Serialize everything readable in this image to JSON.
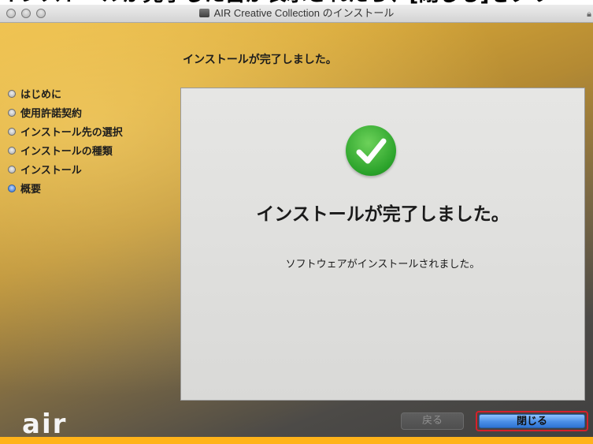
{
  "top_strip": {
    "text": "インストールが完了した旨が表示されたら、[閉じる]をクリ"
  },
  "window": {
    "title": "AIR Creative Collection のインストール",
    "controls": [
      "close-button",
      "minimize-button",
      "zoom-button"
    ]
  },
  "header": {
    "heading": "インストールが完了しました。"
  },
  "sidebar": {
    "steps": [
      {
        "label": "はじめに",
        "active": false
      },
      {
        "label": "使用許諾契約",
        "active": false
      },
      {
        "label": "インストール先の選択",
        "active": false
      },
      {
        "label": "インストールの種類",
        "active": false
      },
      {
        "label": "インストール",
        "active": false
      },
      {
        "label": "概要",
        "active": true
      }
    ]
  },
  "panel": {
    "icon": "checkmark-success-icon",
    "title": "インストールが完了しました。",
    "message": "ソフトウェアがインストールされました。"
  },
  "footer": {
    "logo": "air",
    "back_label": "戻る",
    "close_label": "閉じる"
  },
  "colors": {
    "accent_gold": "#e9b840",
    "check_green": "#2aa22a",
    "button_blue": "#4a8ee6",
    "highlight_red": "#d6202b",
    "bottom_bar_orange": "#ffb31a"
  }
}
